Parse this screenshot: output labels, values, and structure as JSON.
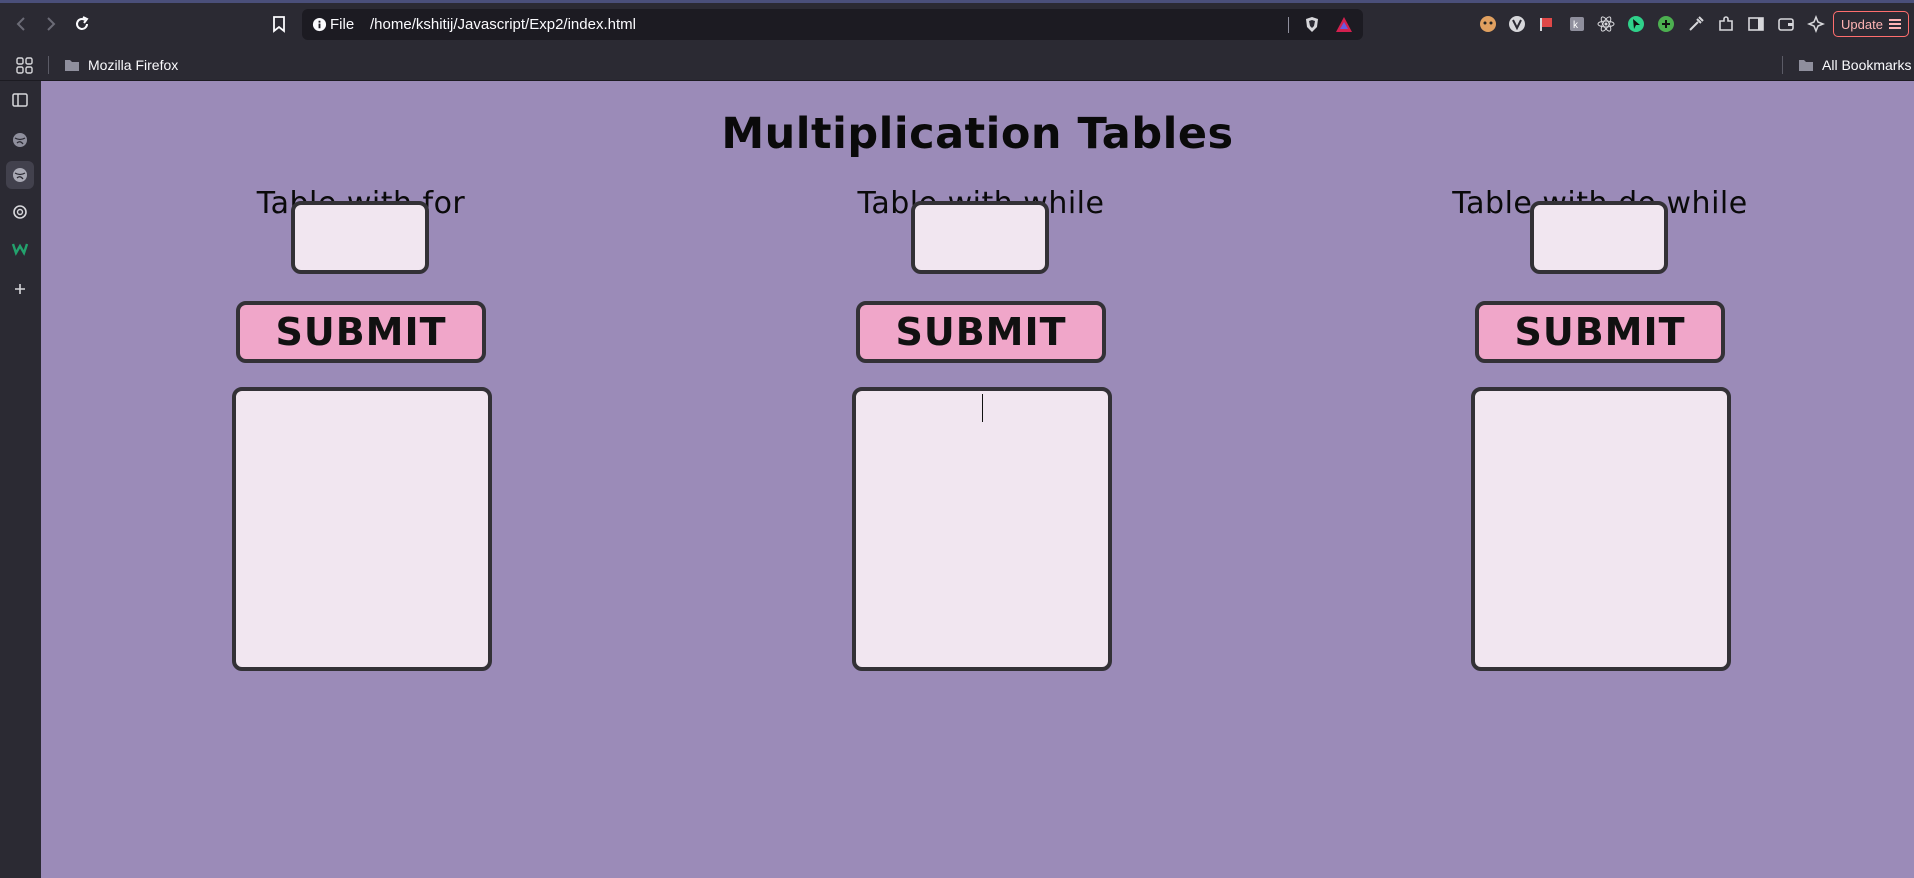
{
  "browser": {
    "url_scheme": "File",
    "url_path": "/home/kshitij/Javascript/Exp2/index.html",
    "update_label": "Update",
    "bookmarks": {
      "left_folder": "Mozilla Firefox",
      "right_folder": "All Bookmarks"
    },
    "colors": {
      "chrome": "#2b2a33",
      "urlbar": "#1c1b22",
      "update_border": "#ff6e6e"
    }
  },
  "page": {
    "title": "Multiplication Tables",
    "background": "#9b8bb8",
    "columns": [
      {
        "heading": "Table with for",
        "input_value": "",
        "submit_label": "SUBMIT",
        "output": ""
      },
      {
        "heading": "Table with while",
        "input_value": "",
        "submit_label": "SUBMIT",
        "output": ""
      },
      {
        "heading": "Table with do while",
        "input_value": "",
        "submit_label": "SUBMIT",
        "output": ""
      }
    ],
    "colors": {
      "button": "#f0a6c9",
      "field": "#f1e6f0",
      "border": "#333136"
    }
  },
  "sidebar_icons": [
    "sidebar-panel-icon",
    "globe-icon",
    "globe-icon",
    "chatgpt-icon",
    "w-logo-icon",
    "plus-icon"
  ],
  "toolbar_icons": [
    "back-icon",
    "forward-icon",
    "reload-icon",
    "bookmark-icon",
    "info-icon",
    "brave-shield-icon",
    "brave-rewards-icon"
  ]
}
